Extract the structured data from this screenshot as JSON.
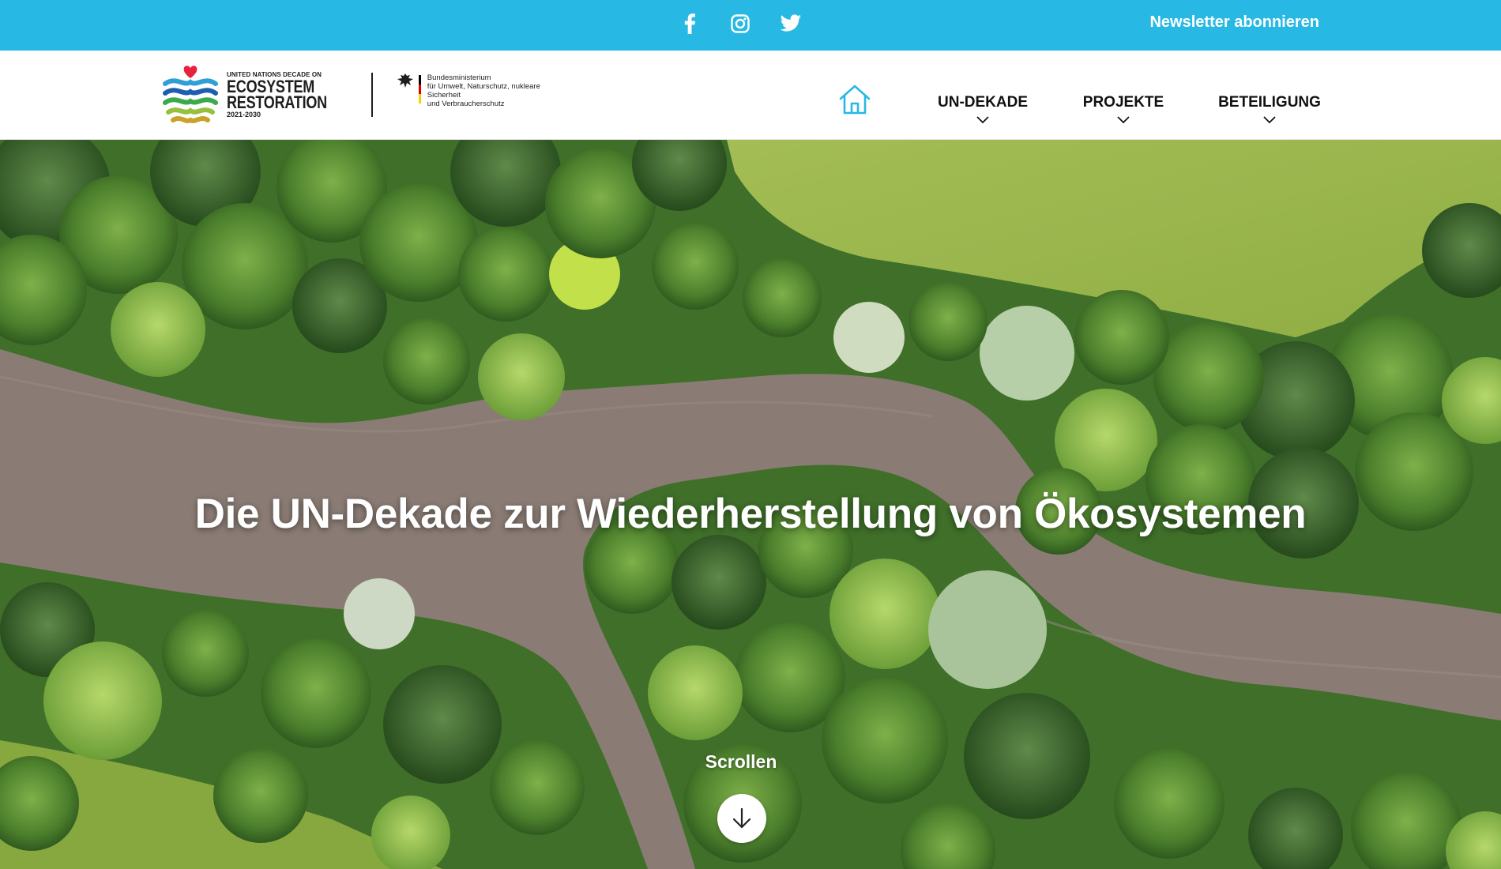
{
  "topbar": {
    "social_icons": [
      "facebook-icon",
      "instagram-icon",
      "twitter-icon"
    ],
    "newsletter_label": "Newsletter abonnieren",
    "background_color": "#27b9e3"
  },
  "header": {
    "un_logo": {
      "line1": "UNITED NATIONS DECADE ON",
      "line2": "ECOSYSTEM",
      "line3": "RESTORATION",
      "years": "2021-2030"
    },
    "ministry_logo": {
      "line1": "Bundesministerium",
      "line2": "für Umwelt, Naturschutz, nukleare Sicherheit",
      "line3": "und Verbraucherschutz"
    },
    "nav": {
      "home_icon": "home-icon",
      "items": [
        {
          "label": "UN-DEKADE"
        },
        {
          "label": "PROJEKTE"
        },
        {
          "label": "BETEILIGUNG"
        }
      ]
    }
  },
  "hero": {
    "title": "Die UN-Dekade zur Wiederherstellung von Ökosystemen",
    "scroll_label": "Scrollen",
    "scroll_icon": "arrow-down-icon"
  },
  "colors": {
    "accent": "#27b9e3",
    "nav_text": "#111111",
    "river": "#8a7c74",
    "meadow": "#9ab84a"
  }
}
